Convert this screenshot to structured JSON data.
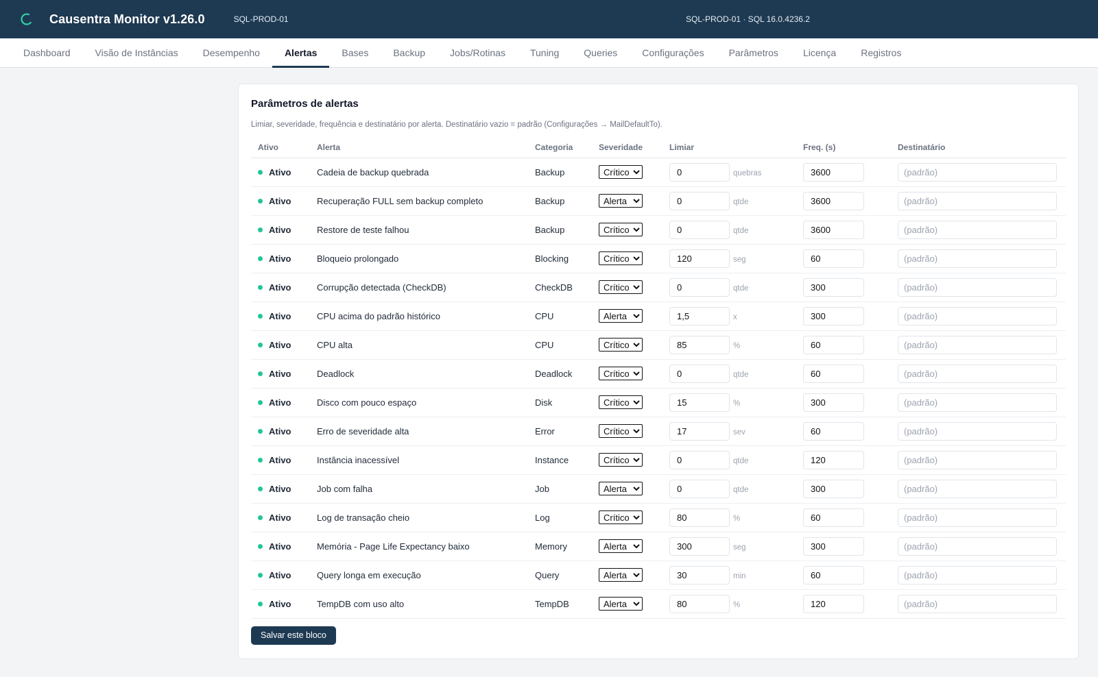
{
  "app": {
    "title": "Causentra Monitor v1.26.0",
    "instance": "SQL-PROD-01",
    "server_info": "SQL-PROD-01 · SQL 16.0.4236.2",
    "accent_color": "#1e3a52",
    "logo_icon": "spinner-ring-icon"
  },
  "tabs": [
    {
      "label": "Dashboard",
      "active": false
    },
    {
      "label": "Visão de Instâncias",
      "active": false
    },
    {
      "label": "Desempenho",
      "active": false
    },
    {
      "label": "Alertas",
      "active": true
    },
    {
      "label": "Bases",
      "active": false
    },
    {
      "label": "Backup",
      "active": false
    },
    {
      "label": "Jobs/Rotinas",
      "active": false
    },
    {
      "label": "Tuning",
      "active": false
    },
    {
      "label": "Queries",
      "active": false
    },
    {
      "label": "Configurações",
      "active": false
    },
    {
      "label": "Parâmetros",
      "active": false
    },
    {
      "label": "Licença",
      "active": false
    },
    {
      "label": "Registros",
      "active": false
    }
  ],
  "card": {
    "title": "Parâmetros de alertas",
    "subtitle": "Limiar, severidade, frequência e destinatário por alerta. Destinatário vazio = padrão (Configurações → MailDefaultTo).",
    "save_label": "Salvar este bloco"
  },
  "table": {
    "headers": {
      "ativo": "Ativo",
      "alerta": "Alerta",
      "categoria": "Categoria",
      "severidade": "Severidade",
      "limiar": "Limiar",
      "freq": "Freq. (s)",
      "destinatario": "Destinatário"
    },
    "severity_options": [
      "Crítico",
      "Alerta"
    ],
    "destinatario_placeholder": "(padrão)",
    "status_color": "#22c59a",
    "rows": [
      {
        "status": "Ativo",
        "alerta": "Cadeia de backup quebrada",
        "categoria": "Backup",
        "severidade": "Crítico",
        "limiar": "0",
        "unidade": "quebras",
        "freq": "3600",
        "destinatario": ""
      },
      {
        "status": "Ativo",
        "alerta": "Recuperação FULL sem backup completo",
        "categoria": "Backup",
        "severidade": "Alerta",
        "limiar": "0",
        "unidade": "qtde",
        "freq": "3600",
        "destinatario": ""
      },
      {
        "status": "Ativo",
        "alerta": "Restore de teste falhou",
        "categoria": "Backup",
        "severidade": "Crítico",
        "limiar": "0",
        "unidade": "qtde",
        "freq": "3600",
        "destinatario": ""
      },
      {
        "status": "Ativo",
        "alerta": "Bloqueio prolongado",
        "categoria": "Blocking",
        "severidade": "Crítico",
        "limiar": "120",
        "unidade": "seg",
        "freq": "60",
        "destinatario": ""
      },
      {
        "status": "Ativo",
        "alerta": "Corrupção detectada (CheckDB)",
        "categoria": "CheckDB",
        "severidade": "Crítico",
        "limiar": "0",
        "unidade": "qtde",
        "freq": "300",
        "destinatario": ""
      },
      {
        "status": "Ativo",
        "alerta": "CPU acima do padrão histórico",
        "categoria": "CPU",
        "severidade": "Alerta",
        "limiar": "1,5",
        "unidade": "x",
        "freq": "300",
        "destinatario": ""
      },
      {
        "status": "Ativo",
        "alerta": "CPU alta",
        "categoria": "CPU",
        "severidade": "Crítico",
        "limiar": "85",
        "unidade": "%",
        "freq": "60",
        "destinatario": ""
      },
      {
        "status": "Ativo",
        "alerta": "Deadlock",
        "categoria": "Deadlock",
        "severidade": "Crítico",
        "limiar": "0",
        "unidade": "qtde",
        "freq": "60",
        "destinatario": ""
      },
      {
        "status": "Ativo",
        "alerta": "Disco com pouco espaço",
        "categoria": "Disk",
        "severidade": "Crítico",
        "limiar": "15",
        "unidade": "%",
        "freq": "300",
        "destinatario": ""
      },
      {
        "status": "Ativo",
        "alerta": "Erro de severidade alta",
        "categoria": "Error",
        "severidade": "Crítico",
        "limiar": "17",
        "unidade": "sev",
        "freq": "60",
        "destinatario": ""
      },
      {
        "status": "Ativo",
        "alerta": "Instância inacessível",
        "categoria": "Instance",
        "severidade": "Crítico",
        "limiar": "0",
        "unidade": "qtde",
        "freq": "120",
        "destinatario": ""
      },
      {
        "status": "Ativo",
        "alerta": "Job com falha",
        "categoria": "Job",
        "severidade": "Alerta",
        "limiar": "0",
        "unidade": "qtde",
        "freq": "300",
        "destinatario": ""
      },
      {
        "status": "Ativo",
        "alerta": "Log de transação cheio",
        "categoria": "Log",
        "severidade": "Crítico",
        "limiar": "80",
        "unidade": "%",
        "freq": "60",
        "destinatario": ""
      },
      {
        "status": "Ativo",
        "alerta": "Memória - Page Life Expectancy baixo",
        "categoria": "Memory",
        "severidade": "Alerta",
        "limiar": "300",
        "unidade": "seg",
        "freq": "300",
        "destinatario": ""
      },
      {
        "status": "Ativo",
        "alerta": "Query longa em execução",
        "categoria": "Query",
        "severidade": "Alerta",
        "limiar": "30",
        "unidade": "min",
        "freq": "60",
        "destinatario": ""
      },
      {
        "status": "Ativo",
        "alerta": "TempDB com uso alto",
        "categoria": "TempDB",
        "severidade": "Alerta",
        "limiar": "80",
        "unidade": "%",
        "freq": "120",
        "destinatario": ""
      }
    ]
  }
}
